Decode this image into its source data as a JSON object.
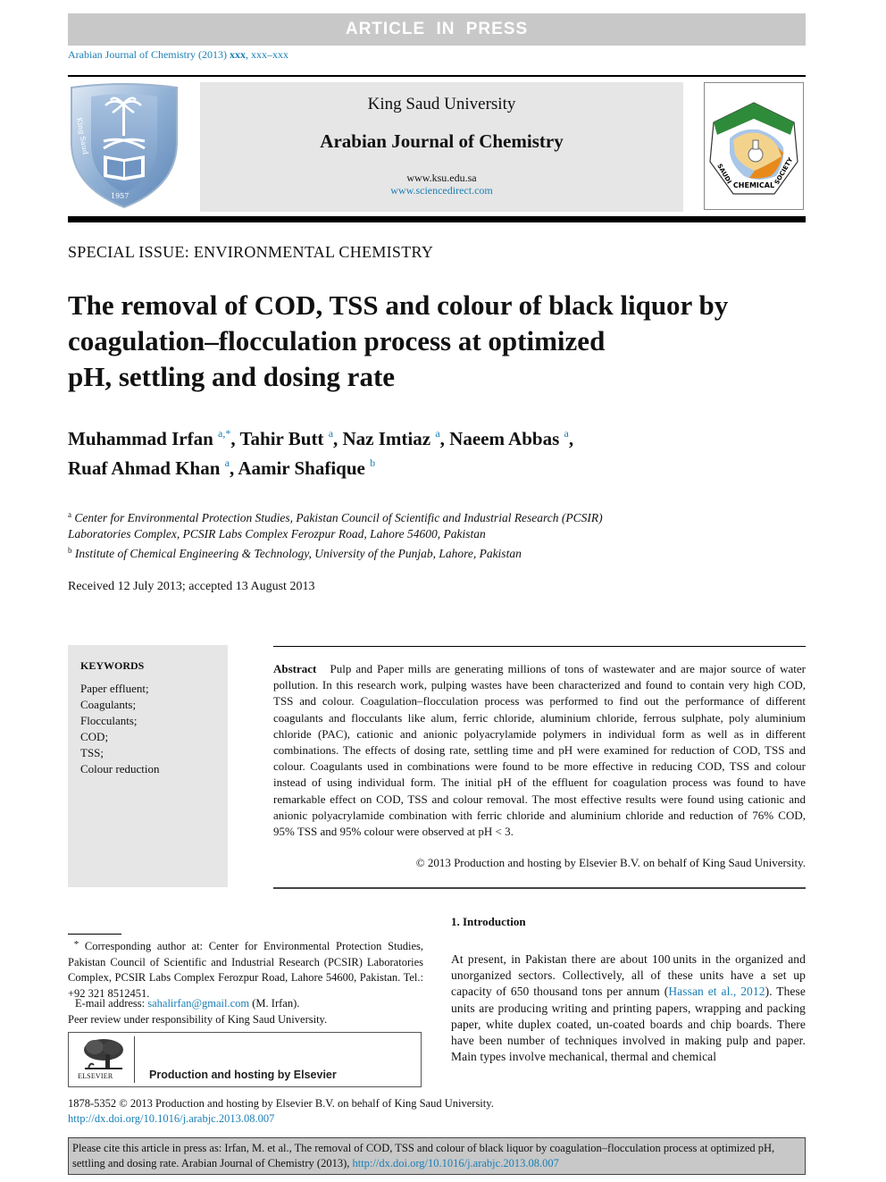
{
  "banner": {
    "label": "ARTICLE IN PRESS"
  },
  "journal_ref": {
    "prefix": "Arabian Journal of Chemistry (2013) ",
    "volume": "xxx",
    "pages": ", xxx–xxx"
  },
  "header": {
    "university": "King Saud University",
    "journal_name": "Arabian Journal of Chemistry",
    "url_ksu": "www.ksu.edu.sa",
    "url_sciencedirect": "www.sciencedirect.com",
    "left_logo": "king-saud-university-emblem",
    "right_logo": "saudi-chemical-society-emblem",
    "right_logo_text": "CHEMICAL",
    "right_logo_side_left": "SAUDI",
    "right_logo_side_right": "SOCIETY",
    "left_logo_text_left": "King Saud University",
    "left_logo_year": "1957"
  },
  "special_issue": "SPECIAL ISSUE: ENVIRONMENTAL CHEMISTRY",
  "title": {
    "line1": "The removal of COD, TSS and colour of black liquor by",
    "line2": "coagulation–flocculation process at optimized",
    "line3": "pH, settling and dosing rate"
  },
  "authors": [
    {
      "name": "Muhammad Irfan",
      "aff": "a,*",
      "sep": ", "
    },
    {
      "name": "Tahir Butt",
      "aff": "a",
      "sep": ", "
    },
    {
      "name": "Naz Imtiaz",
      "aff": "a",
      "sep": ", "
    },
    {
      "name": "Naeem Abbas",
      "aff": "a",
      "sep": ","
    },
    {
      "name": "Ruaf Ahmad Khan",
      "aff": "a",
      "sep": ", "
    },
    {
      "name": "Aamir Shafique",
      "aff": "b",
      "sep": ""
    }
  ],
  "affiliations": [
    {
      "mark": "a",
      "line1": "Center for Environmental Protection Studies, Pakistan Council of Scientific and Industrial Research (PCSIR)",
      "line2": "Laboratories Complex, PCSIR Labs Complex Ferozpur Road, Lahore 54600, Pakistan"
    },
    {
      "mark": "b",
      "line1": "Institute of Chemical Engineering & Technology, University of the Punjab, Lahore, Pakistan"
    }
  ],
  "received": "Received 12 July 2013; accepted 13 August 2013",
  "keywords": {
    "title": "KEYWORDS",
    "items": [
      "Paper effluent;",
      "Coagulants;",
      "Flocculants;",
      "COD;",
      "TSS;",
      "Colour reduction"
    ]
  },
  "abstract": {
    "label": "Abstract",
    "text": "Pulp and Paper mills are generating millions of tons of wastewater and are major source of water pollution. In this research work, pulping wastes have been characterized and found to contain very high COD, TSS and colour. Coagulation–flocculation process was performed to find out the performance of different coagulants and flocculants like alum, ferric chloride, aluminium chloride, ferrous sulphate, poly aluminium chloride (PAC), cationic and anionic polyacrylamide polymers in individual form as well as in different combinations. The effects of dosing rate, settling time and pH were examined for reduction of COD, TSS and colour. Coagulants used in combinations were found to be more effective in reducing COD, TSS and colour instead of using individual form. The initial pH of the effluent for coagulation process was found to have remarkable effect on COD, TSS and colour removal. The most effective results were found using cationic and anionic polyacrylamide combination with ferric chloride and aluminium chloride and reduction of 76% COD, 95% TSS and 95% colour were observed at pH < 3.",
    "copyright": "© 2013 Production and hosting by Elsevier B.V. on behalf of King Saud University."
  },
  "footnote": {
    "mark": "*",
    "corresponding": "Corresponding author at: Center for Environmental Protection Studies, Pakistan Council of Scientific and Industrial Research (PCSIR) Laboratories Complex, PCSIR Labs Complex Ferozpur Road, Lahore 54600, Pakistan. Tel.: +92 321 8512451.",
    "email_label": "E-mail address: ",
    "email": "sahalirfan@gmail.com",
    "email_suffix": " (M. Irfan).",
    "peer_review": "Peer review under responsibility of King Saud University.",
    "publisher_logo_label": "ELSEVIER",
    "publisher_text": "Production and hosting by Elsevier"
  },
  "introduction": {
    "heading": "1. Introduction",
    "text_before_cite": "At present, in Pakistan there are about 100 units in the organized and unorganized sectors. Collectively, all of these units have a set up capacity of 650 thousand tons per annum (",
    "cite": "Hassan et al., 2012",
    "text_after_cite": "). These units are producing writing and printing papers, wrapping and packing paper, white duplex coated, un-coated boards and chip boards. There have been number of techniques involved in making pulp and paper. Main types involve mechanical, thermal and chemical"
  },
  "bottom": {
    "issn": "1878-5352 © 2013 Production and hosting by Elsevier B.V. on behalf of King Saud University.",
    "doi": "http://dx.doi.org/10.1016/j.arabjc.2013.08.007",
    "cite_text": "Please cite this article in press as: Irfan, M. et al., The removal of COD, TSS and colour of black liquor by coagulation–flocculation process at optimized pH, settling and dosing rate. Arabian Journal of Chemistry (2013), ",
    "cite_doi": "http://dx.doi.org/10.1016/j.arabjc.2013.08.007"
  }
}
